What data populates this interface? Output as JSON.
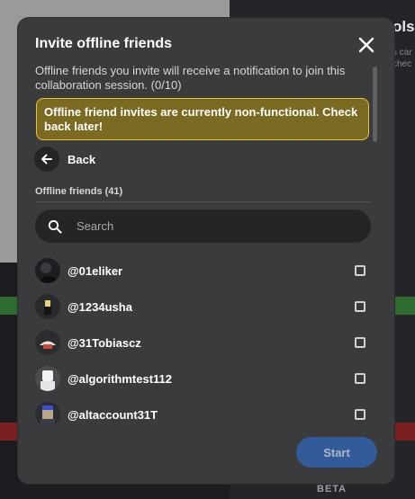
{
  "background": {
    "side_title": "ols",
    "side_sub": "s car\nchec",
    "beta_label": "BETA"
  },
  "modal": {
    "title": "Invite offline friends",
    "close_icon": "close-icon",
    "description": "Offline friends you invite will receive a notification to join this collaboration session. (0/10)",
    "warning": "Offline friend invites are currently non-functional. Check back later!",
    "back_label": "Back",
    "section_label": "Offline friends (41)",
    "search": {
      "placeholder": "Search",
      "value": ""
    },
    "friends": [
      {
        "name": "@01eliker",
        "checked": false,
        "avatar_icon": "avatar-icon"
      },
      {
        "name": "@1234usha",
        "checked": false,
        "avatar_icon": "avatar-icon"
      },
      {
        "name": "@31Tobiascz",
        "checked": false,
        "avatar_icon": "avatar-icon"
      },
      {
        "name": "@algorithmtest112",
        "checked": false,
        "avatar_icon": "avatar-icon"
      },
      {
        "name": "@altaccount31T",
        "checked": false,
        "avatar_icon": "avatar-icon"
      }
    ],
    "start_label": "Start"
  },
  "colors": {
    "modal_bg": "#393b3d",
    "warning_bg": "#7a6a22",
    "warning_border": "#e5c43a",
    "start_bg": "#335fa3"
  }
}
